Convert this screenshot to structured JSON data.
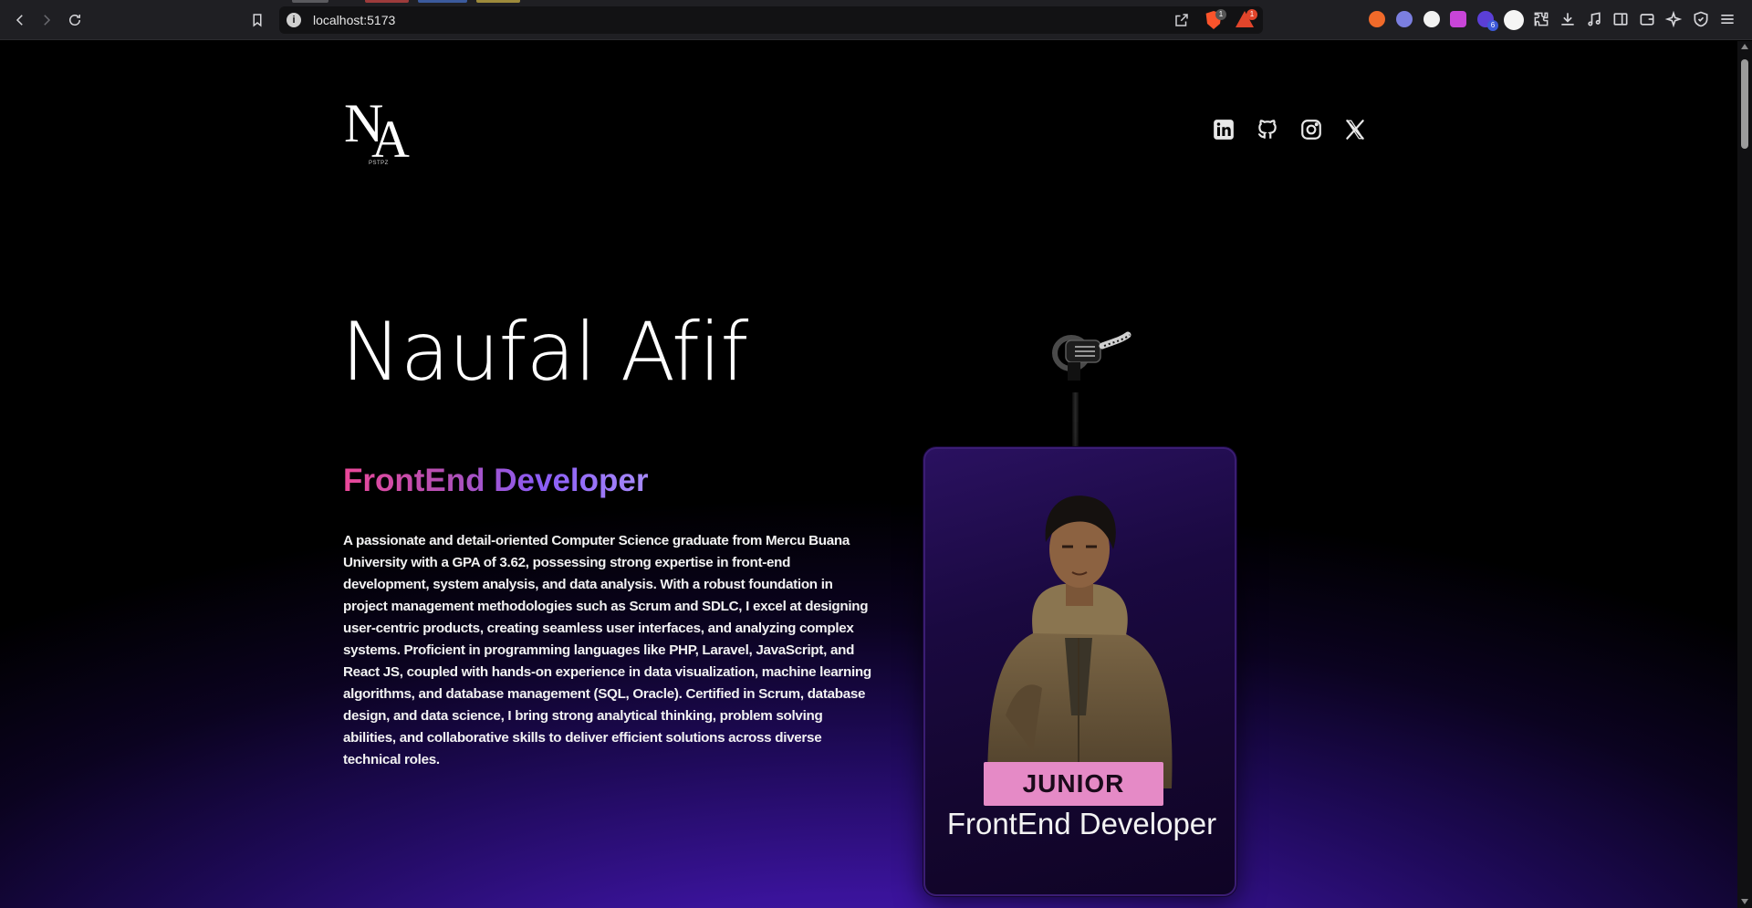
{
  "browser": {
    "url": "localhost:5173",
    "rewards_badge": "1",
    "brave_badge": "1",
    "extension_badge": "6"
  },
  "site": {
    "logo_sub": "PSTPZ",
    "social": [
      "linkedin-icon",
      "github-icon",
      "instagram-icon",
      "x-icon"
    ]
  },
  "hero": {
    "name": "Naufal Afif",
    "role": "FrontEnd Developer",
    "description": "A passionate and detail-oriented Computer Science graduate from Mercu Buana University with a GPA of 3.62, possessing strong expertise in front-end development, system analysis, and data analysis. With a robust foundation in project management methodologies such as Scrum and SDLC, I excel at designing user-centric products, creating seamless user interfaces, and analyzing complex systems. Proficient in programming languages like PHP, Laravel, JavaScript, and React JS, coupled with hands-on experience in data visualization, machine learning algorithms, and database management (SQL, Oracle). Certified in Scrum, database design, and data science, I bring strong analytical thinking, problem solving abilities, and collaborative skills to deliver efficient solutions across diverse technical roles."
  },
  "card": {
    "level": "JUNIOR",
    "title": "FrontEnd Developer"
  },
  "colors": {
    "accent_pink": "#ec4899",
    "accent_purple": "#8b5cf6",
    "badge_pink": "#e58ac6",
    "bg_purple": "#4a1cb3"
  }
}
